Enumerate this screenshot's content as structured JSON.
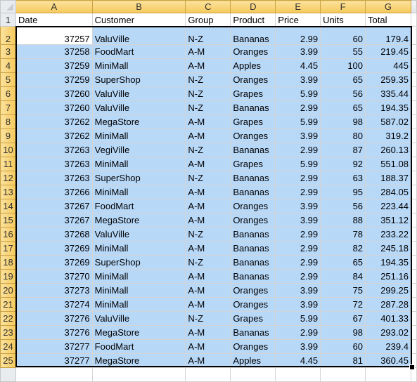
{
  "column_headers": [
    "A",
    "B",
    "C",
    "D",
    "E",
    "F",
    "G"
  ],
  "header_row": {
    "row_number": "1",
    "cells": [
      "Date",
      "Customer",
      "Group",
      "Product",
      "Price",
      "Units",
      "Total"
    ]
  },
  "rows": [
    {
      "n": "2",
      "date": "37257",
      "customer": "ValuVille",
      "group": "N-Z",
      "product": "Bananas",
      "price": "2.99",
      "units": "60",
      "total": "179.4"
    },
    {
      "n": "3",
      "date": "37258",
      "customer": "FoodMart",
      "group": "A-M",
      "product": "Oranges",
      "price": "3.99",
      "units": "55",
      "total": "219.45"
    },
    {
      "n": "4",
      "date": "37259",
      "customer": "MiniMall",
      "group": "A-M",
      "product": "Apples",
      "price": "4.45",
      "units": "100",
      "total": "445"
    },
    {
      "n": "5",
      "date": "37259",
      "customer": "SuperShop",
      "group": "N-Z",
      "product": "Oranges",
      "price": "3.99",
      "units": "65",
      "total": "259.35"
    },
    {
      "n": "6",
      "date": "37260",
      "customer": "ValuVille",
      "group": "N-Z",
      "product": "Grapes",
      "price": "5.99",
      "units": "56",
      "total": "335.44"
    },
    {
      "n": "7",
      "date": "37260",
      "customer": "ValuVille",
      "group": "N-Z",
      "product": "Bananas",
      "price": "2.99",
      "units": "65",
      "total": "194.35"
    },
    {
      "n": "8",
      "date": "37262",
      "customer": "MegaStore",
      "group": "A-M",
      "product": "Grapes",
      "price": "5.99",
      "units": "98",
      "total": "587.02"
    },
    {
      "n": "9",
      "date": "37262",
      "customer": "MiniMall",
      "group": "A-M",
      "product": "Oranges",
      "price": "3.99",
      "units": "80",
      "total": "319.2"
    },
    {
      "n": "10",
      "date": "37263",
      "customer": "VegiVille",
      "group": "N-Z",
      "product": "Bananas",
      "price": "2.99",
      "units": "87",
      "total": "260.13"
    },
    {
      "n": "11",
      "date": "37263",
      "customer": "MiniMall",
      "group": "A-M",
      "product": "Grapes",
      "price": "5.99",
      "units": "92",
      "total": "551.08"
    },
    {
      "n": "12",
      "date": "37263",
      "customer": "SuperShop",
      "group": "N-Z",
      "product": "Bananas",
      "price": "2.99",
      "units": "63",
      "total": "188.37"
    },
    {
      "n": "13",
      "date": "37266",
      "customer": "MiniMall",
      "group": "A-M",
      "product": "Bananas",
      "price": "2.99",
      "units": "95",
      "total": "284.05"
    },
    {
      "n": "14",
      "date": "37267",
      "customer": "FoodMart",
      "group": "A-M",
      "product": "Oranges",
      "price": "3.99",
      "units": "56",
      "total": "223.44"
    },
    {
      "n": "15",
      "date": "37267",
      "customer": "MegaStore",
      "group": "A-M",
      "product": "Oranges",
      "price": "3.99",
      "units": "88",
      "total": "351.12"
    },
    {
      "n": "16",
      "date": "37268",
      "customer": "ValuVille",
      "group": "N-Z",
      "product": "Bananas",
      "price": "2.99",
      "units": "78",
      "total": "233.22"
    },
    {
      "n": "17",
      "date": "37269",
      "customer": "MiniMall",
      "group": "A-M",
      "product": "Bananas",
      "price": "2.99",
      "units": "82",
      "total": "245.18"
    },
    {
      "n": "18",
      "date": "37269",
      "customer": "SuperShop",
      "group": "N-Z",
      "product": "Bananas",
      "price": "2.99",
      "units": "65",
      "total": "194.35"
    },
    {
      "n": "19",
      "date": "37270",
      "customer": "MiniMall",
      "group": "A-M",
      "product": "Bananas",
      "price": "2.99",
      "units": "84",
      "total": "251.16"
    },
    {
      "n": "20",
      "date": "37273",
      "customer": "MiniMall",
      "group": "A-M",
      "product": "Oranges",
      "price": "3.99",
      "units": "75",
      "total": "299.25"
    },
    {
      "n": "21",
      "date": "37274",
      "customer": "MiniMall",
      "group": "A-M",
      "product": "Oranges",
      "price": "3.99",
      "units": "72",
      "total": "287.28"
    },
    {
      "n": "22",
      "date": "37276",
      "customer": "ValuVille",
      "group": "N-Z",
      "product": "Grapes",
      "price": "5.99",
      "units": "67",
      "total": "401.33"
    },
    {
      "n": "23",
      "date": "37276",
      "customer": "MegaStore",
      "group": "A-M",
      "product": "Bananas",
      "price": "2.99",
      "units": "98",
      "total": "293.02"
    },
    {
      "n": "24",
      "date": "37277",
      "customer": "FoodMart",
      "group": "A-M",
      "product": "Oranges",
      "price": "3.99",
      "units": "60",
      "total": "239.4"
    },
    {
      "n": "25",
      "date": "37277",
      "customer": "MegaStore",
      "group": "A-M",
      "product": "Apples",
      "price": "4.45",
      "units": "81",
      "total": "360.45"
    }
  ],
  "selection": {
    "range": "A2:G25",
    "active_cell": "A2"
  },
  "colors": {
    "selection_fill": "#b8d8f8",
    "header_highlight": "#f6c95a",
    "gridline": "#d4d4d4"
  }
}
